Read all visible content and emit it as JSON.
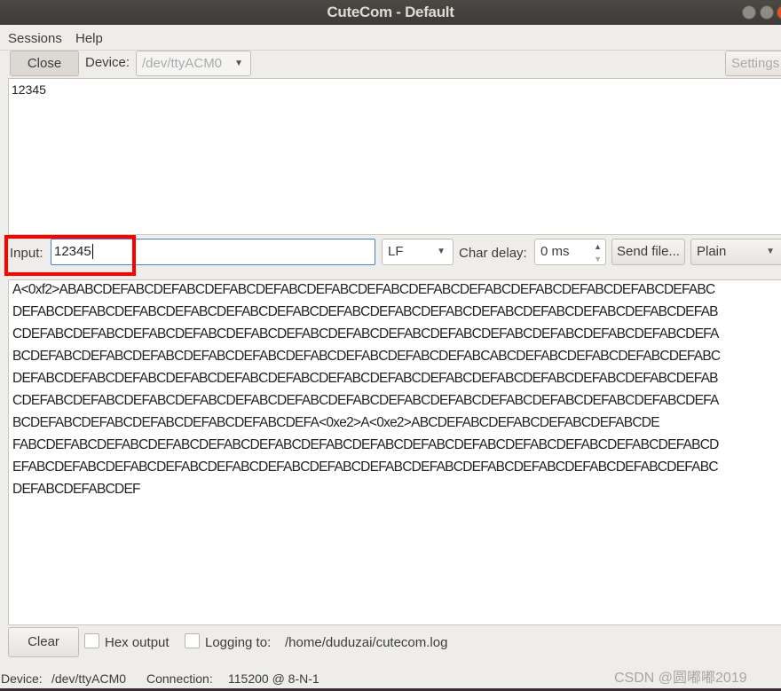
{
  "window": {
    "title": "CuteCom - Default",
    "accent": "#e95420"
  },
  "menu": [
    "Sessions",
    "Help"
  ],
  "toolbar": {
    "close_label": "Close",
    "device_label": "Device:",
    "device_value": "/dev/ttyACM0",
    "settings_label": "Settings"
  },
  "sent": {
    "text": "12345"
  },
  "input_row": {
    "input_label": "Input:",
    "input_value": "12345",
    "line_end": "LF",
    "char_delay_label": "Char delay:",
    "char_delay_value": "0 ms",
    "send_file_label": "Send file...",
    "format": "Plain",
    "highlight_color": "#ff0000"
  },
  "output": {
    "lines": [
      "A<0xf2>ABABCDEFABCDEFABCDEFABCDEFABCDEFABCDEFABCDEFABCDEFABCDEFABCDEFABCDEFABCDEFABC",
      "DEFABCDEFABCDEFABCDEFABCDEFABCDEFABCDEFABCDEFABCDEFABCDEFABCDEFABCDEFABCDEFABCDEFAB",
      "CDEFABCDEFABCDEFABCDEFABCDEFABCDEFABCDEFABCDEFABCDEFABCDEFABCDEFABCDEFABCDEFABCDEFA",
      "BCDEFABCDEFABCDEFABCDEFABCDEFABCDEFABCDEFABCDEFABCDEFABCABCDEFABCDEFABCDEFABCDEFABC",
      "DEFABCDEFABCDEFABCDEFABCDEFABCDEFABCDEFABCDEFABCDEFABCDEFABCDEFABCDEFABCDEFABCDEFAB",
      "CDEFABCDEFABCDEFABCDEFABCDEFABCDEFABCDEFABCDEFABCDEFABCDEFABCDEFABCDEFABCDEFABCDEFA",
      "BCDEFABCDEFABCDEFABCDEFABCDEFABCDEFA<0xe2>A<0xe2>ABCDEFABCDEFABCDEFABCDEFABCDE",
      "FABCDEFABCDEFABCDEFABCDEFABCDEFABCDEFABCDEFABCDEFABCDEFABCDEFABCDEFABCDEFABCDEFABCD",
      "EFABCDEFABCDEFABCDEFABCDEFABCDEFABCDEFABCDEFABCDEFABCDEFABCDEFABCDEFABCDEFABCDEFABC",
      "DEFABCDEFABCDEF"
    ]
  },
  "bottom": {
    "clear_label": "Clear",
    "hex_output_label": "Hex output",
    "logging_label": "Logging to:",
    "log_path": "/home/duduzai/cutecom.log"
  },
  "status": {
    "device_label": "Device:",
    "device_value": "/dev/ttyACM0",
    "connection_label": "Connection:",
    "connection_value": "115200 @ 8-N-1"
  },
  "watermark": "CSDN @圆嘟嘟2019"
}
